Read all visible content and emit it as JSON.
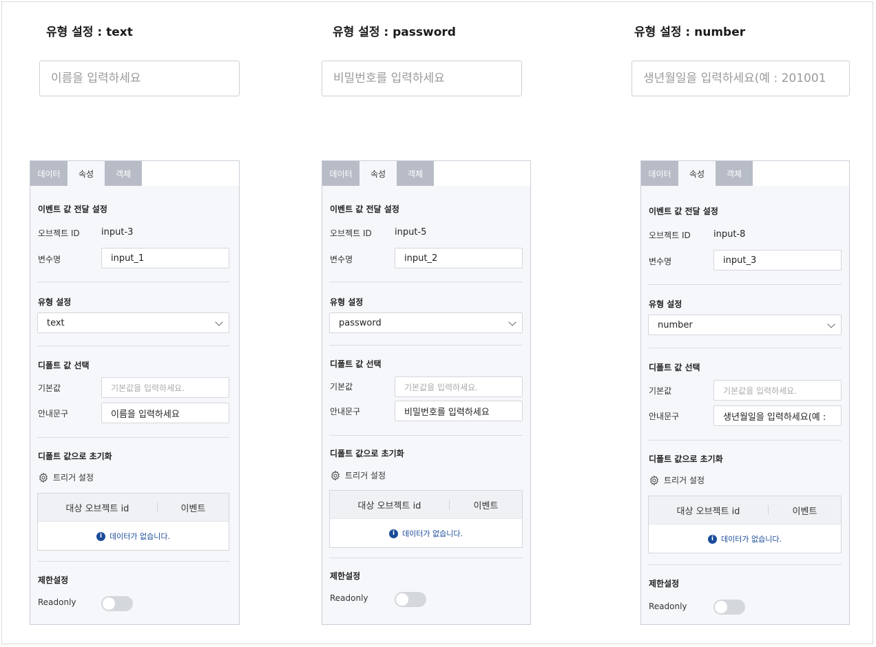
{
  "titles": [
    "유형 설정 : text",
    "유형 설정 : password",
    "유형 설정 : number"
  ],
  "demo_inputs": [
    {
      "placeholder": "이름을 입력하세요"
    },
    {
      "placeholder": "비밀번호를 입력하세요"
    },
    {
      "placeholder": "생년월일을 입력하세요(예 : 201001"
    }
  ],
  "tabs": [
    "데이터",
    "속성",
    "객체"
  ],
  "labels": {
    "event_section": "이벤트 값 전달 설정",
    "object_id": "오브젝트 ID",
    "var_name": "변수명",
    "type_section": "유형 설정",
    "default_section": "디폴트 값 선택",
    "default_value": "기본값",
    "guide_text": "안내문구",
    "default_value_placeholder": "기본값을 입력하세요.",
    "reset_section": "디폴트 값으로 초기화",
    "trigger": "트리거 설정",
    "col_target": "대상 오브젝트 id",
    "col_event": "이벤트",
    "empty": "데이터가 없습니다.",
    "limit_section": "제한설정",
    "readonly": "Readonly"
  },
  "panels": [
    {
      "object_id": "input-3",
      "var_name": "input_1",
      "type": "text",
      "guide": "이름을 입력하세요",
      "readonly": false
    },
    {
      "object_id": "input-5",
      "var_name": "input_2",
      "type": "password",
      "guide": "비밀번호를 입력하세요",
      "readonly": false
    },
    {
      "object_id": "input-8",
      "var_name": "input_3",
      "type": "number",
      "guide": "생년월일을 입력하세요(예 :",
      "readonly": false
    }
  ],
  "icons": {
    "gear": "gear-icon",
    "info": "info-icon",
    "chevron": "chevron-down-icon"
  }
}
